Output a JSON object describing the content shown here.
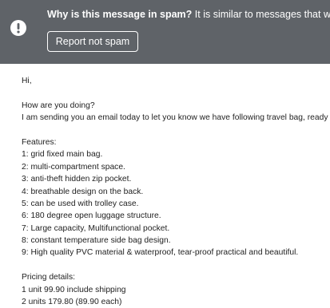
{
  "banner": {
    "icon": "exclamation-circle-icon",
    "background_color": "#5f6368",
    "title": "Why is this message in spam?",
    "reason": " It is similar to messages that were ide",
    "report_button_label": "Report not spam"
  },
  "email": {
    "greeting": "Hi,",
    "intro": [
      "How are you doing?",
      "I am sending you an email today to let you know we have following travel bag, ready"
    ],
    "features_heading": "Features:",
    "features": [
      "1: grid fixed main bag.",
      "2: multi-compartment space.",
      "3: anti-theft hidden zip pocket.",
      "4: breathable design on the back.",
      "5: can be used with trolley case.",
      "6: 180 degree open luggage structure.",
      "7: Large capacity, Multifunctional pocket.",
      "8: constant temperature side bag design.",
      "9: High quality PVC material & waterproof, tear-proof practical and beautiful."
    ],
    "pricing_heading": "Pricing details:",
    "pricing": [
      "1 unit 99.90  include shipping",
      "2 units 179.80 (89.90 each)"
    ]
  }
}
